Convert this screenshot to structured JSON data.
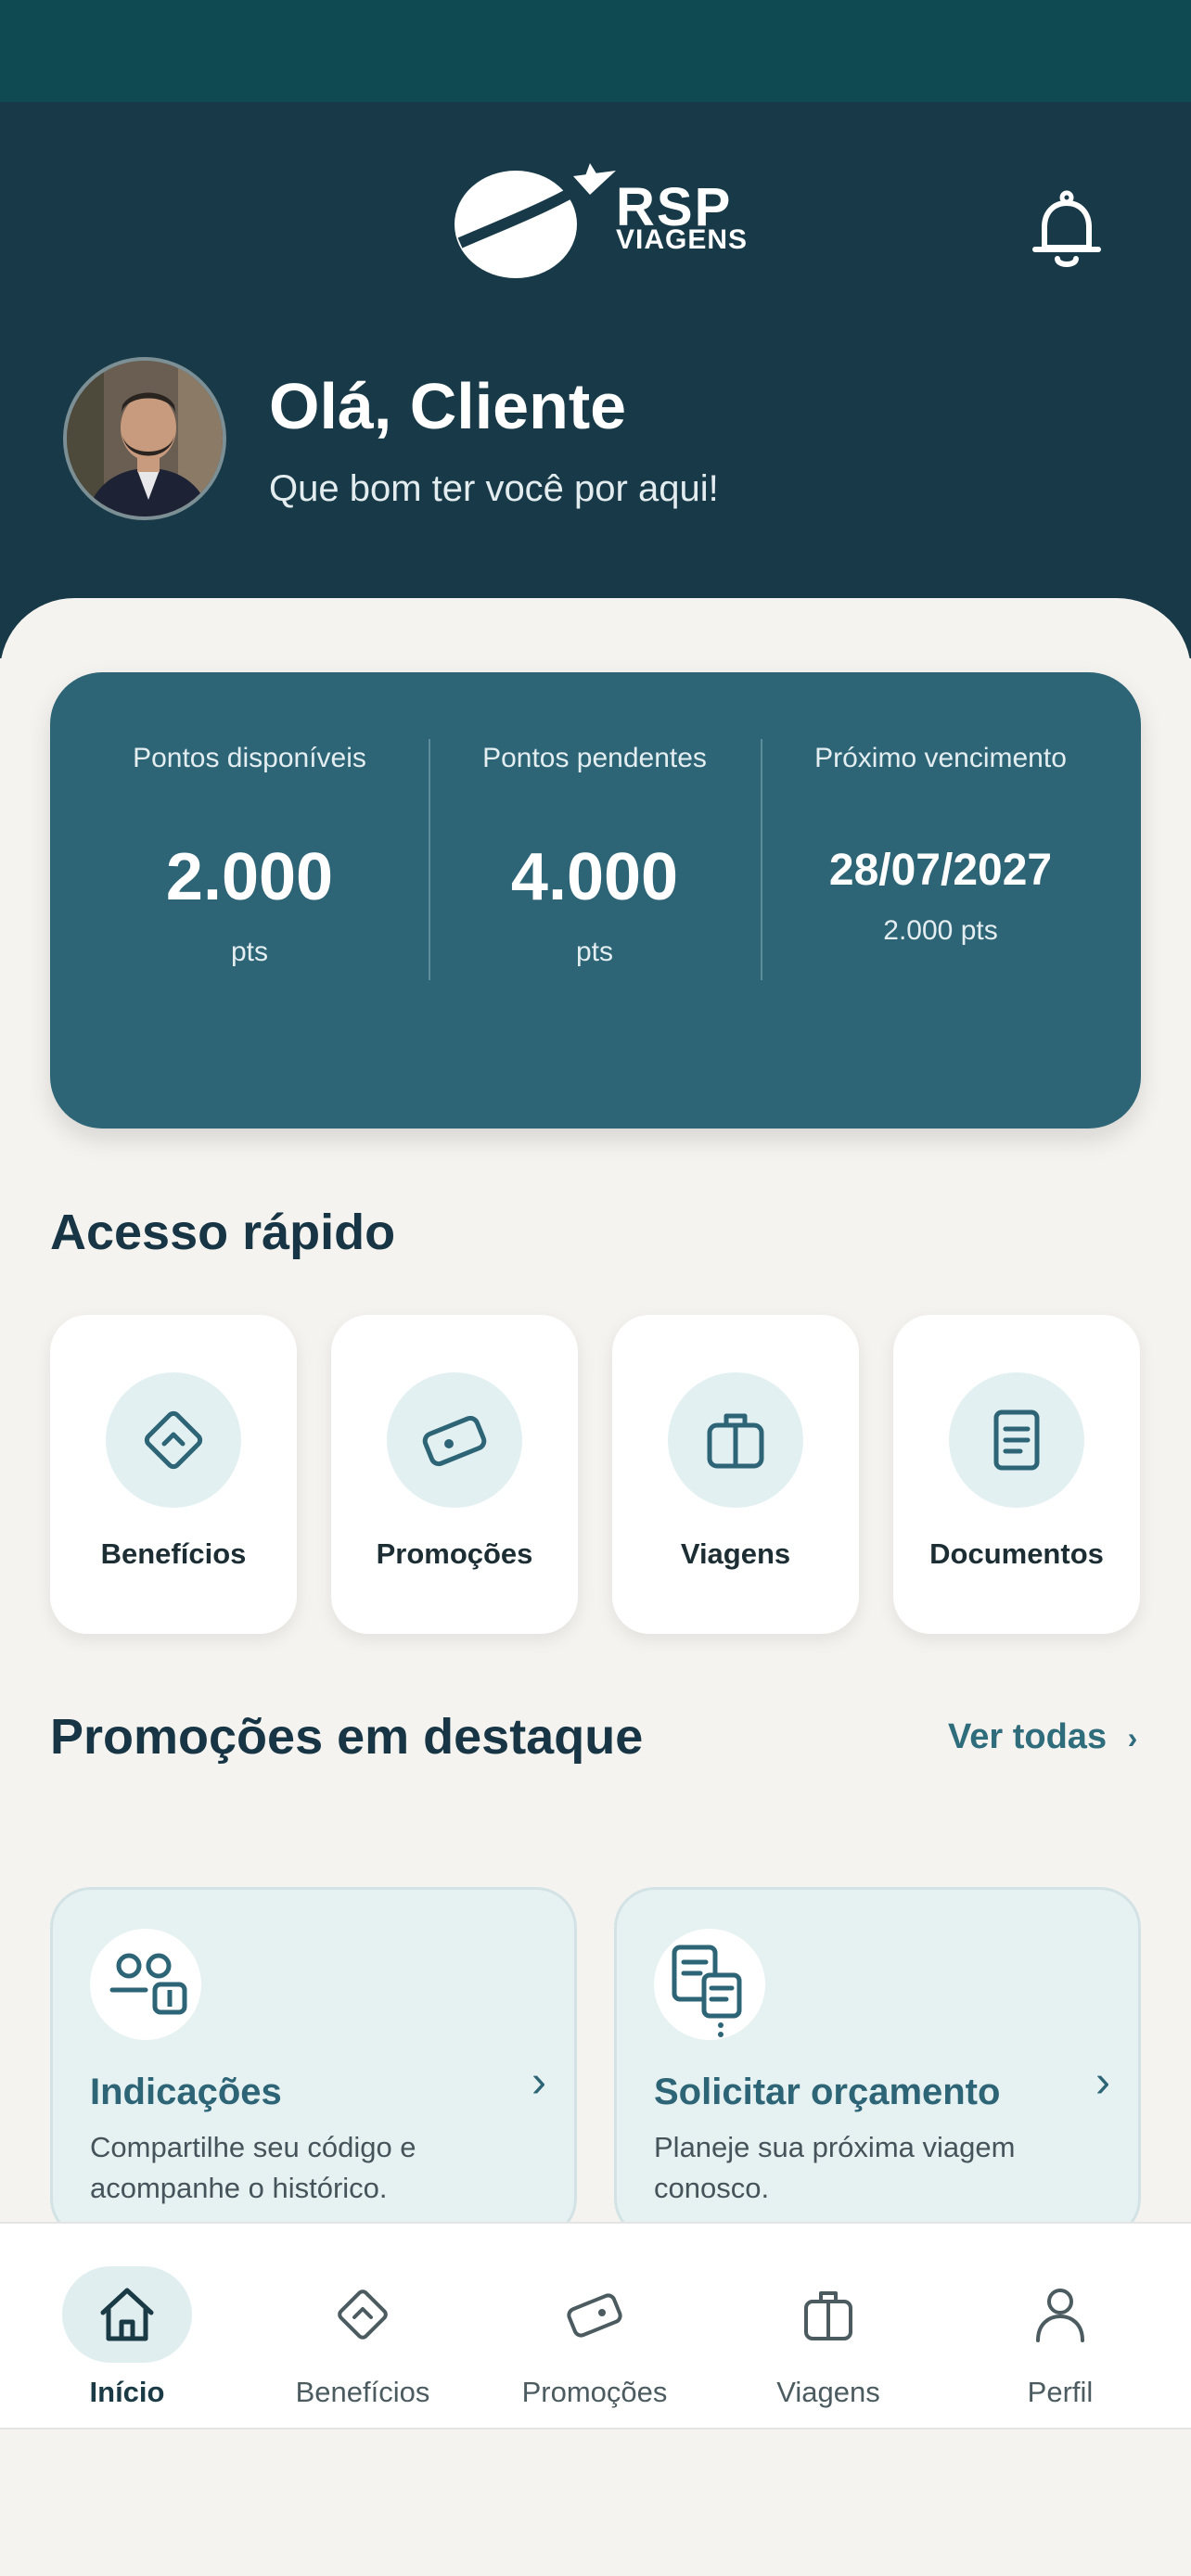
{
  "brand": {
    "line1": "RSP",
    "line2": "VIAGENS"
  },
  "icons": {
    "logo": "plane-globe-logo",
    "notifications": "bell-icon",
    "avatar": "user-photo-avatar"
  },
  "greeting": {
    "title": "Olá, Cliente",
    "subtitle": "Que bom ter você por aqui!"
  },
  "points": {
    "available": {
      "label": "Pontos disponíveis",
      "value": "2.000",
      "unit": "pts"
    },
    "pending": {
      "label": "Pontos pendentes",
      "value": "4.000",
      "unit": "pts"
    },
    "expiry": {
      "label": "Próximo vencimento",
      "date": "28/07/2027",
      "amount": "2.000 pts"
    }
  },
  "quick_access": {
    "title": "Acesso rápido",
    "items": [
      {
        "label": "Benefícios",
        "icon": "diamond-icon"
      },
      {
        "label": "Promoções",
        "icon": "ticket-icon"
      },
      {
        "label": "Viagens",
        "icon": "suitcase-icon"
      },
      {
        "label": "Documentos",
        "icon": "document-icon"
      }
    ]
  },
  "featured": {
    "title": "Promoções em destaque",
    "see_all": "Ver todas",
    "cards": [
      {
        "title": "Indicações",
        "description": "Compartilhe seu código e acompanhe o histórico.",
        "icon": "referral-icon"
      },
      {
        "title": "Solicitar orçamento",
        "description": "Planeje sua próxima viagem conosco.",
        "icon": "quote-documents-icon"
      }
    ]
  },
  "bottom_nav": {
    "active": "Início",
    "items": [
      {
        "label": "Início",
        "icon": "home-icon"
      },
      {
        "label": "Benefícios",
        "icon": "diamond-icon"
      },
      {
        "label": "Promoções",
        "icon": "ticket-icon"
      },
      {
        "label": "Viagens",
        "icon": "suitcase-icon"
      },
      {
        "label": "Perfil",
        "icon": "user-icon"
      }
    ]
  },
  "colors": {
    "status_bar": "#0f4a52",
    "header": "#183a48",
    "card": "#2d6577",
    "accent": "#2f6c7c",
    "background": "#f5f3ef"
  }
}
